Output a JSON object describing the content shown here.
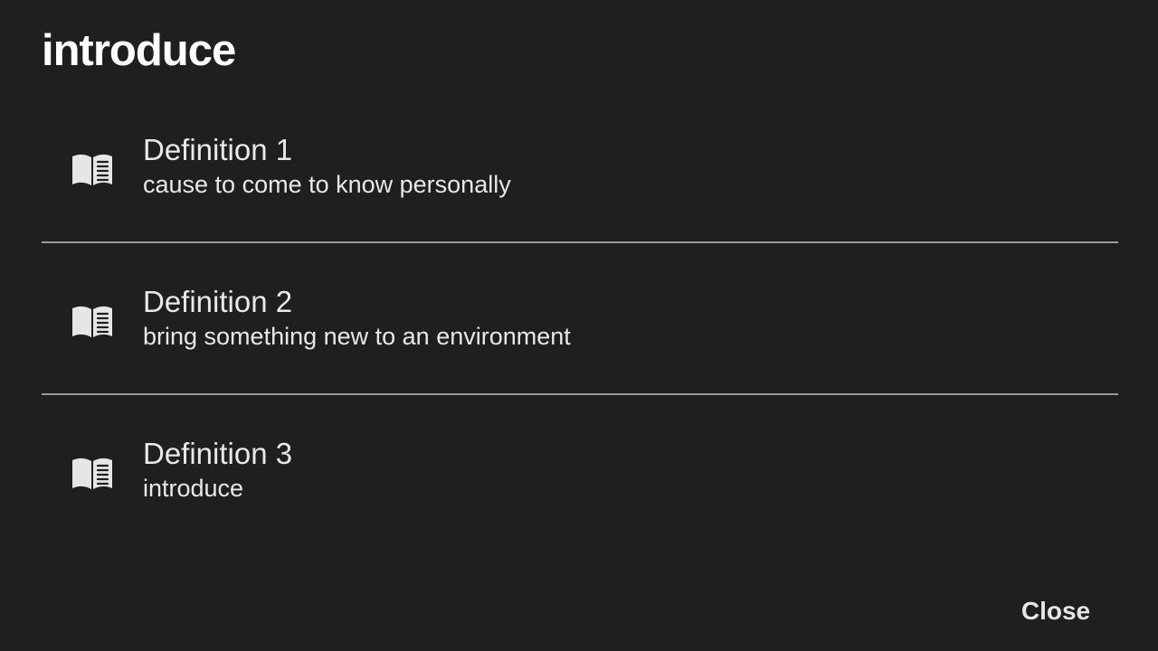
{
  "dialog": {
    "title": "introduce",
    "definitions": [
      {
        "heading": "Definition 1",
        "text": "cause to come to know personally",
        "icon": "book-icon"
      },
      {
        "heading": "Definition 2",
        "text": "bring something new to an environment",
        "icon": "book-icon"
      },
      {
        "heading": "Definition 3",
        "text": "introduce",
        "icon": "book-icon"
      }
    ],
    "close_label": "Close"
  },
  "colors": {
    "background": "#1f1f1f",
    "text": "#e8e8e8",
    "title": "#ffffff",
    "divider": "#9a9a9a"
  }
}
